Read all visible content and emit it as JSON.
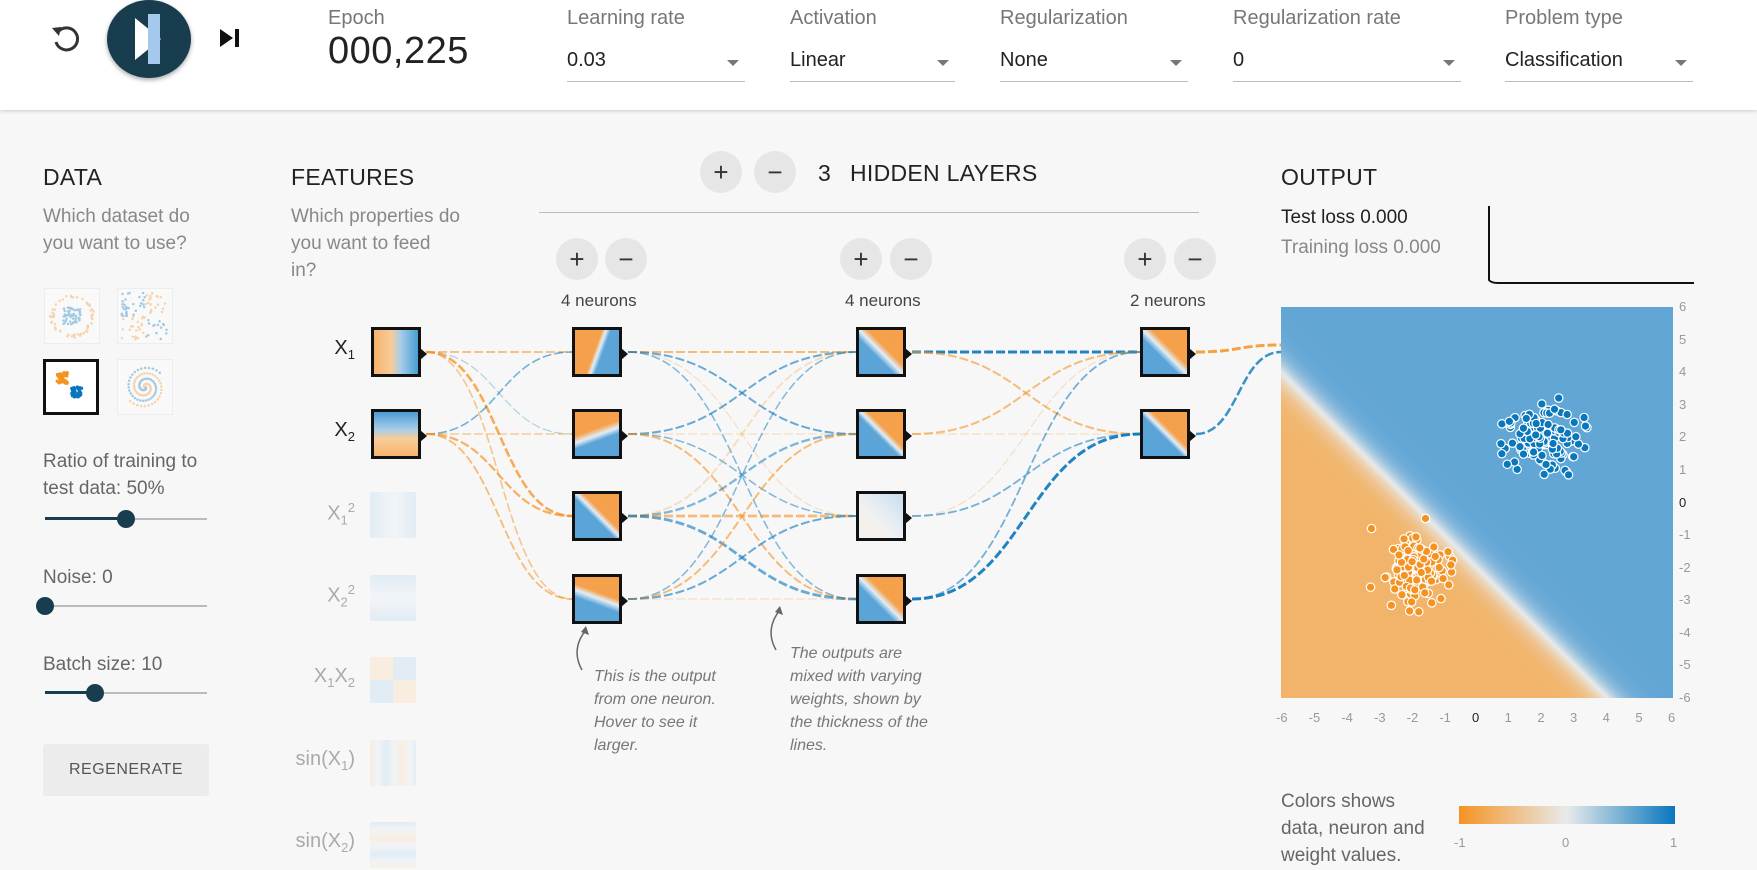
{
  "controls": {
    "epoch_label": "Epoch",
    "epoch_value": "000,225",
    "learning_rate": {
      "label": "Learning rate",
      "value": "0.03"
    },
    "activation": {
      "label": "Activation",
      "value": "Linear"
    },
    "regularization": {
      "label": "Regularization",
      "value": "None"
    },
    "regularization_rate": {
      "label": "Regularization rate",
      "value": "0"
    },
    "problem_type": {
      "label": "Problem type",
      "value": "Classification"
    }
  },
  "data": {
    "title": "DATA",
    "subtitle": "Which dataset do you want to use?",
    "datasets": [
      "circle",
      "xor",
      "gaussian",
      "spiral"
    ],
    "selected_dataset": "gaussian",
    "ratio_label": "Ratio of training to test data:  50%",
    "ratio_value": 0.5,
    "noise_label": "Noise:  0",
    "noise_value": 0,
    "batch_label": "Batch size:  10",
    "batch_value": 0.31,
    "regenerate_label": "REGENERATE"
  },
  "features": {
    "title": "FEATURES",
    "subtitle": "Which properties do you want to feed in?"
  },
  "network": {
    "hidden_layer_count": "3",
    "hidden_layers_label": "HIDDEN LAYERS",
    "layers": [
      {
        "neurons_label": "4 neurons"
      },
      {
        "neurons_label": "4 neurons"
      },
      {
        "neurons_label": "2 neurons"
      }
    ],
    "hint_neuron": "This is the output from one neuron. Hover to see it larger.",
    "hint_weights": "The outputs are mixed with varying weights, shown by the thickness of the lines."
  },
  "output": {
    "title": "OUTPUT",
    "test_loss": "Test loss 0.000",
    "training_loss": "Training loss 0.000",
    "x_ticks": [
      "-6",
      "-5",
      "-4",
      "-3",
      "-2",
      "-1",
      "0",
      "1",
      "2",
      "3",
      "4",
      "5",
      "6"
    ],
    "y_ticks": [
      "6",
      "5",
      "4",
      "3",
      "2",
      "1",
      "0",
      "-1",
      "-2",
      "-3",
      "-4",
      "-5",
      "-6"
    ],
    "legend_text": "Colors shows data, neuron and weight values.",
    "legend_min": "-1",
    "legend_mid": "0",
    "legend_max": "1"
  },
  "colors": {
    "orange": "#f59322",
    "blue": "#0877bd",
    "dark": "#183d4e"
  }
}
